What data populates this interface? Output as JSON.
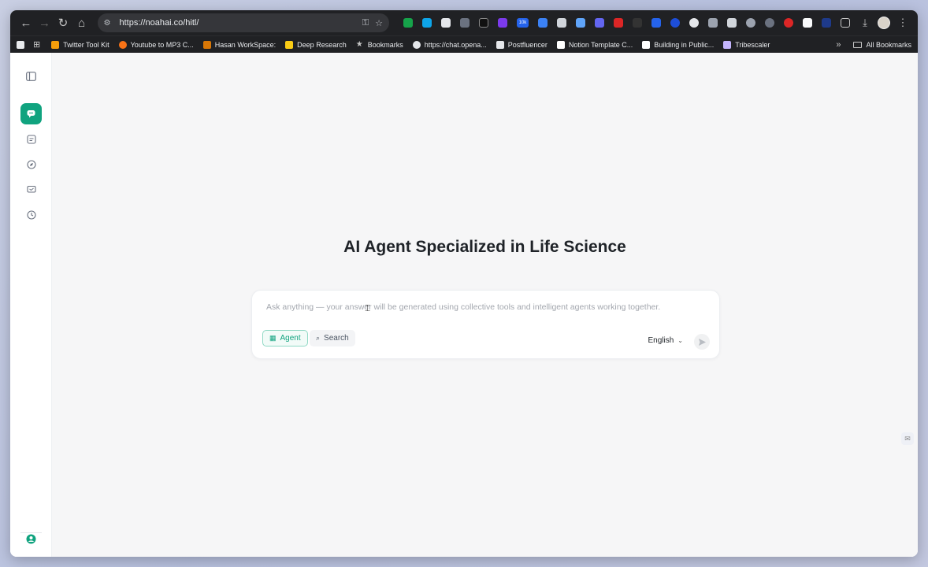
{
  "browser": {
    "url": "https://noahai.co/hitl/",
    "bookmarks": [
      {
        "label": "Twitter Tool Kit",
        "color": "#f59e0b"
      },
      {
        "label": "Youtube to MP3 C...",
        "color": "#f97316"
      },
      {
        "label": "Hasan WorkSpace:",
        "color": "#d97706"
      },
      {
        "label": "Deep Research",
        "color": "#facc15"
      },
      {
        "label": "Bookmarks",
        "color": "#9ca3af"
      },
      {
        "label": "https://chat.opena...",
        "color": "#e5e7eb"
      },
      {
        "label": "Postfluencer",
        "color": "#e5e7eb"
      },
      {
        "label": "Notion Template C...",
        "color": "#ffffff"
      },
      {
        "label": "Building in Public...",
        "color": "#ffffff"
      },
      {
        "label": "Tribescaler",
        "color": "#c4b5fd"
      }
    ],
    "all_bookmarks": "All Bookmarks",
    "extension_badge": "10k"
  },
  "sidebar": {
    "items": [
      "toggle-sidebar",
      "chat",
      "documents",
      "explore",
      "messages",
      "history"
    ]
  },
  "main": {
    "headline": "AI Agent Specialized in Life Science",
    "prompt_placeholder": "Ask anything — your answer will be generated using collective tools and intelligent agents working together.",
    "modes": {
      "agent": "Agent",
      "search": "Search"
    },
    "language": "English"
  },
  "colors": {
    "accent": "#10a37f"
  }
}
